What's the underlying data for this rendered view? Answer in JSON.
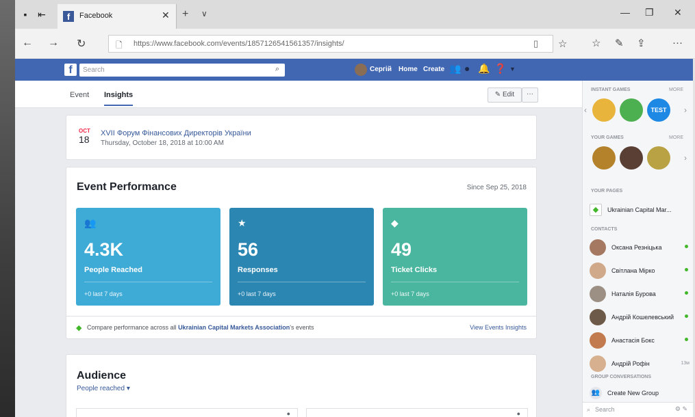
{
  "browser": {
    "tab_title": "Facebook",
    "url": "https://www.facebook.com/events/1857126541561357/insights/",
    "close_glyph": "✕",
    "new_tab_glyph": "+",
    "tablist_glyph": "∨",
    "minimize_glyph": "—",
    "restore_glyph": "❐",
    "window_close_glyph": "✕"
  },
  "fb": {
    "logo": "f",
    "search_placeholder": "Search",
    "nav_home": "Home",
    "nav_create": "Create",
    "user_name": "Сергій"
  },
  "subnav": {
    "tabs": [
      "Event",
      "Insights"
    ],
    "edit_label": "✎ Edit",
    "more_label": "···"
  },
  "event": {
    "month": "OCT",
    "day": "18",
    "title": "XVII Форум Фінансових Директорів України",
    "date_line": "Thursday, October 18, 2018 at 10:00 AM"
  },
  "performance": {
    "title": "Event Performance",
    "since": "Since Sep 25, 2018",
    "stats": [
      {
        "icon": "people-icon",
        "glyph": "👥",
        "value": "4.3K",
        "label": "People Reached",
        "delta": "+0 last 7 days",
        "color": "#3eaad6"
      },
      {
        "icon": "star-icon",
        "glyph": "★",
        "value": "56",
        "label": "Responses",
        "delta": "+0 last 7 days",
        "color": "#2b86b2"
      },
      {
        "icon": "ticket-icon",
        "glyph": "◆",
        "value": "49",
        "label": "Ticket Clicks",
        "delta": "+0 last 7 days",
        "color": "#4bb6a0"
      }
    ],
    "compare_prefix": "Compare performance across all ",
    "compare_org": "Ukrainian Capital Markets Association",
    "compare_suffix": "'s events",
    "view_link": "View Events Insights"
  },
  "audience": {
    "title": "Audience",
    "subtitle": "People reached ▾"
  },
  "sidebar": {
    "instant_games": "INSTANT GAMES",
    "more": "MORE",
    "your_games": "YOUR GAMES",
    "your_pages": "YOUR PAGES",
    "page_name": "Ukrainian Capital Mar...",
    "contacts": "CONTACTS",
    "contact_list": [
      {
        "name": "Оксана Резніцька",
        "meta": ""
      },
      {
        "name": "Світлана Мірко",
        "meta": ""
      },
      {
        "name": "Наталія Бурова",
        "meta": ""
      },
      {
        "name": "Андрій Кошелевський",
        "meta": ""
      },
      {
        "name": "Анастасія Бокс",
        "meta": ""
      },
      {
        "name": "Андрій Рофін",
        "meta": "13м"
      }
    ],
    "group_conv": "GROUP CONVERSATIONS",
    "create_group": "Create New Group",
    "search_placeholder": "Search"
  }
}
